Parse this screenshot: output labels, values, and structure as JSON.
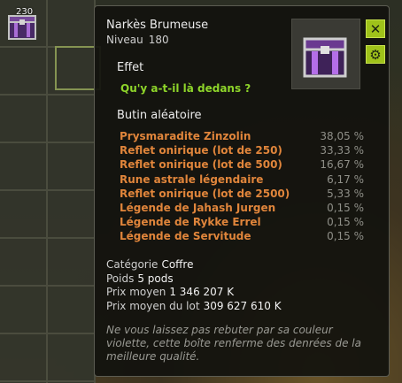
{
  "inventory": {
    "stack_count": "230"
  },
  "tooltip": {
    "item_name": "Narkès Brumeuse",
    "level_label": "Niveau",
    "level_value": "180",
    "effect_header": "Effet",
    "effect_text": "Qu'y a-t-il là dedans ?",
    "loot_header": "Butin aléatoire",
    "loot": [
      {
        "name": "Prysmaradite Zinzolin",
        "pct": "38,05 %"
      },
      {
        "name": "Reflet onirique (lot de 250)",
        "pct": "33,33 %"
      },
      {
        "name": "Reflet onirique (lot de 500)",
        "pct": "16,67 %"
      },
      {
        "name": "Rune astrale légendaire",
        "pct": "6,17 %"
      },
      {
        "name": "Reflet onirique (lot de 2500)",
        "pct": "5,33 %"
      },
      {
        "name": "Légende de Jahash Jurgen",
        "pct": "0,15 %"
      },
      {
        "name": "Légende de Rykke Errel",
        "pct": "0,15 %"
      },
      {
        "name": "Légende de Servitude",
        "pct": "0,15 %"
      }
    ],
    "category_label": "Catégorie",
    "category_value": "Coffre",
    "weight_label": "Poids",
    "weight_value": "5 pods",
    "avg_price_label": "Prix moyen",
    "avg_price_value": "1 346 207 K",
    "lot_price_label": "Prix moyen du lot",
    "lot_price_value": "309 627 610 K",
    "description": "Ne vous laissez pas rebuter par sa couleur violette, cette boîte renferme des denrées de la meilleure qualité."
  },
  "icons": {
    "close": "close-icon",
    "settings": "gear-icon",
    "item": "chest-icon"
  },
  "colors": {
    "loot_name": "#e0853b",
    "effect": "#8ed52a",
    "button": "#9fc21a"
  }
}
